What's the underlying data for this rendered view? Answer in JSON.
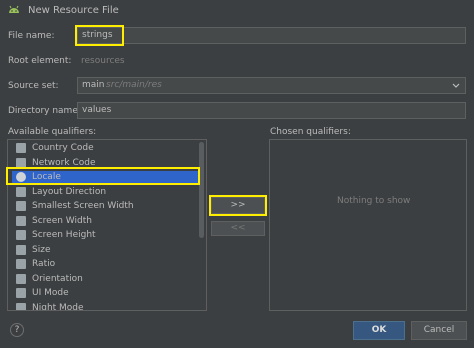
{
  "window": {
    "title": "New Resource File"
  },
  "form": {
    "file_name_label": "File name:",
    "file_name_value": "strings",
    "root_element_label": "Root element:",
    "root_element_value": "resources",
    "source_set_label": "Source set:",
    "source_set_value": "main",
    "source_set_path": "src/main/res",
    "directory_name_label": "Directory name:",
    "directory_name_value": "values"
  },
  "qualifiers": {
    "available_label": "Available qualifiers:",
    "chosen_label": "Chosen qualifiers:",
    "items": [
      {
        "label": "Country Code",
        "icon": "flag-icon"
      },
      {
        "label": "Network Code",
        "icon": "network-icon"
      },
      {
        "label": "Locale",
        "icon": "globe-icon",
        "selected": true
      },
      {
        "label": "Layout Direction",
        "icon": "layout-direction-icon"
      },
      {
        "label": "Smallest Screen Width",
        "icon": "screen-width-icon"
      },
      {
        "label": "Screen Width",
        "icon": "screen-width-icon"
      },
      {
        "label": "Screen Height",
        "icon": "screen-height-icon"
      },
      {
        "label": "Size",
        "icon": "size-icon"
      },
      {
        "label": "Ratio",
        "icon": "ratio-icon"
      },
      {
        "label": "Orientation",
        "icon": "orientation-icon"
      },
      {
        "label": "UI Mode",
        "icon": "ui-mode-icon"
      },
      {
        "label": "Night Mode",
        "icon": "night-mode-icon"
      }
    ],
    "empty_text": "Nothing to show",
    "add_button": ">>",
    "remove_button": "<<"
  },
  "footer": {
    "help": "?",
    "ok": "OK",
    "cancel": "Cancel"
  },
  "colors": {
    "background": "#3c3f41",
    "highlight": "#ffee00",
    "selection": "#2f65ca"
  }
}
